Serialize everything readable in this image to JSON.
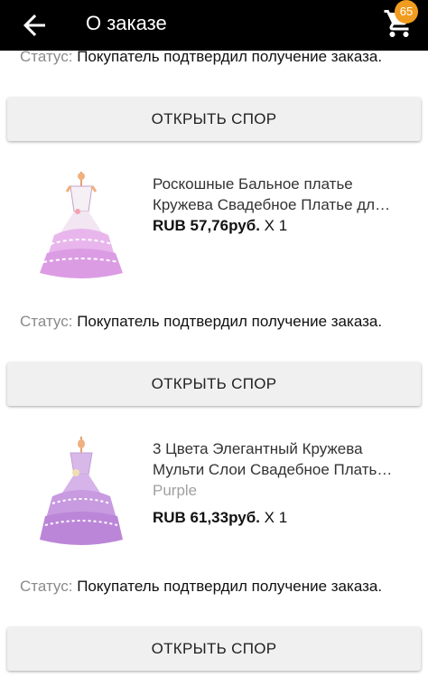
{
  "header": {
    "title": "О заказе",
    "cart_count": "65"
  },
  "status_label": "Статус:",
  "items": [
    {
      "status_value": "Покупатель подтвердил получение заказа.",
      "dispute_label": "ОТКРЫТЬ СПОР"
    },
    {
      "name_line1": "Роскошные Бальное платье",
      "name_line2": "Кружева Свадебное Платье дл…",
      "variant": "",
      "price": "RUB 57,76руб.",
      "qty": "X 1",
      "status_value": "Покупатель подтвердил получение заказа.",
      "dispute_label": "ОТКРЫТЬ СПОР"
    },
    {
      "name_line1": "3 Цвета Элегантный Кружева",
      "name_line2": "Мульти Слои Свадебное Плать…",
      "variant": "Purple",
      "price": "RUB 61,33руб.",
      "qty": "X 1",
      "status_value": "Покупатель подтвердил получение заказа.",
      "dispute_label": "ОТКРЫТЬ СПОР"
    }
  ],
  "colors": {
    "appbar": "#000000",
    "badge": "#f29c1f",
    "button_bg": "#f0f0f0"
  },
  "icons": {
    "back": "arrow-left-icon",
    "cart": "shopping-cart-icon"
  }
}
